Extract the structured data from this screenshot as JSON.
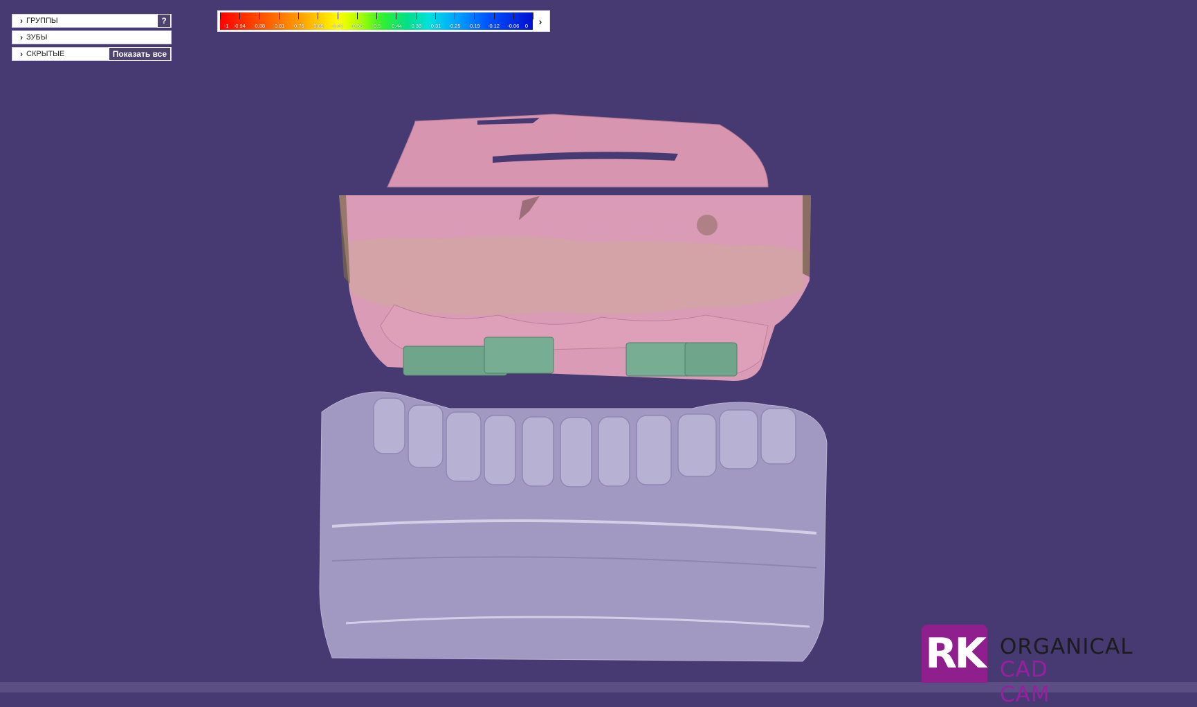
{
  "panels": {
    "groups": {
      "label": "ГРУППЫ",
      "help": "?"
    },
    "teeth": {
      "label": "ЗУБЫ"
    },
    "hidden": {
      "label": "СКРЫТЫЕ",
      "show_all": "Показать все"
    }
  },
  "colorbar": {
    "labels": [
      "-1",
      "-0.94",
      "-0.88",
      "-0.81",
      "-0.75",
      "-0.69",
      "-0.62",
      "-0.56",
      "-0.5",
      "-0.44",
      "-0.38",
      "-0.31",
      "-0.25",
      "-0.19",
      "-0.12",
      "-0.06",
      "0"
    ],
    "expand_icon": "chevron-right-icon"
  },
  "logo": {
    "mark": "RK",
    "line1": "ORGANICAL",
    "line2": "CAD CAM",
    "brand_color": "#8e1f8c"
  },
  "colors": {
    "background": "#473a73",
    "upper_model": "#d99bb5",
    "lower_model": "#a9a2c8",
    "implants": "#6fa58a"
  }
}
